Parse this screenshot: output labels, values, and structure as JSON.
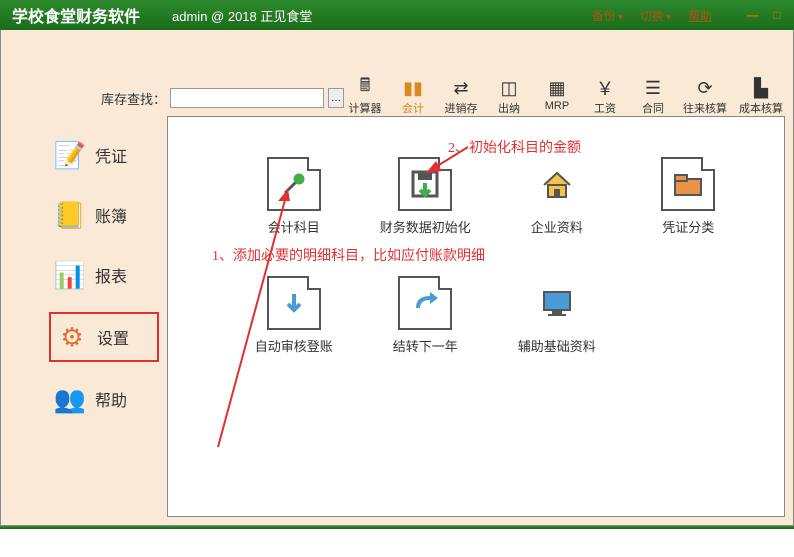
{
  "titlebar": {
    "app_title": "学校食堂财务软件",
    "user_info": "admin @ 2018 正见食堂",
    "backup": "备份",
    "switch": "切换",
    "help": "帮助"
  },
  "search": {
    "label": "库存查找：",
    "value": "",
    "placeholder": ""
  },
  "toolbar": {
    "items": [
      {
        "label": "计算器",
        "icon": "🖩",
        "color": "#333"
      },
      {
        "label": "会计",
        "icon": "▮▮",
        "color": "#d68a1f",
        "active": true
      },
      {
        "label": "进销存",
        "icon": "⇄",
        "color": "#333"
      },
      {
        "label": "出纳",
        "icon": "◫",
        "color": "#333"
      },
      {
        "label": "MRP",
        "icon": "▦",
        "color": "#333"
      },
      {
        "label": "工资",
        "icon": "￥",
        "color": "#333"
      },
      {
        "label": "合同",
        "icon": "☰",
        "color": "#333"
      },
      {
        "label": "往来核算",
        "icon": "⟳",
        "color": "#333"
      },
      {
        "label": "成本核算",
        "icon": "▙",
        "color": "#333"
      }
    ]
  },
  "sidebar": {
    "items": [
      {
        "label": "凭证",
        "icon": "📝",
        "color": "#e09020"
      },
      {
        "label": "账簿",
        "icon": "📒",
        "color": "#c0a020"
      },
      {
        "label": "报表",
        "icon": "📊",
        "color": "#5090c0"
      },
      {
        "label": "设置",
        "icon": "⚙",
        "color": "#e07030",
        "selected": true
      },
      {
        "label": "帮助",
        "icon": "👥",
        "color": "#c04040"
      }
    ]
  },
  "grid": {
    "items": [
      {
        "label": "会计科目",
        "icon": "wrench"
      },
      {
        "label": "财务数据初始化",
        "icon": "save"
      },
      {
        "label": "企业资料",
        "icon": "house"
      },
      {
        "label": "凭证分类",
        "icon": "folder"
      },
      {
        "label": "自动审核登账",
        "icon": "down"
      },
      {
        "label": "结转下一年",
        "icon": "forward"
      },
      {
        "label": "辅助基础资料",
        "icon": "monitor"
      },
      {
        "label": "",
        "icon": "",
        "empty": true
      }
    ]
  },
  "annotations": {
    "anno1": "1、添加必要的明细科目，比如应付账款明细",
    "anno2": "2、初始化科目的金额"
  },
  "colors": {
    "accent_green": "#1a6b1a",
    "bg_tan": "#f9e9d6",
    "red": "#e03030",
    "orange": "#d68a1f"
  }
}
